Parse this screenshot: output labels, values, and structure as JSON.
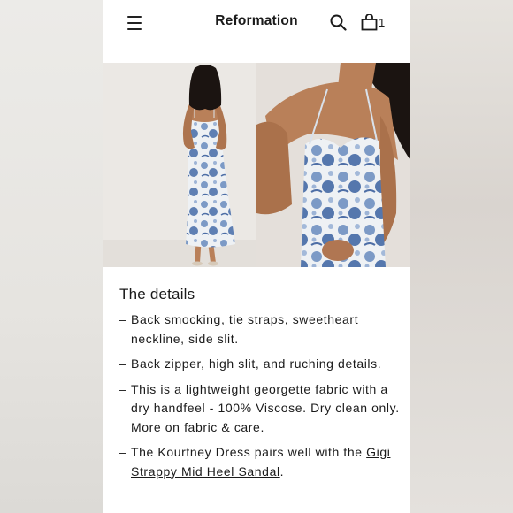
{
  "header": {
    "brand": "Reformation",
    "cart_count": "1"
  },
  "icons": [
    "menu-icon",
    "search-icon",
    "bag-icon"
  ],
  "details": {
    "title": "The details",
    "items": [
      {
        "text": "Back smocking, tie straps, sweetheart neckline, side slit."
      },
      {
        "text": "Back zipper, high slit, and ruching details."
      },
      {
        "text_before": "This is a lightweight georgette fabric with a dry handfeel - 100% Viscose. Dry clean only. More on ",
        "link": "fabric & care",
        "text_after": "."
      },
      {
        "text_before": "The Kourtney Dress pairs well with the ",
        "link": "Gigi Strappy Mid Heel Sandal",
        "text_after": "."
      }
    ],
    "dash": "–"
  },
  "colors": {
    "dress_blue": "#6f8fbd",
    "dress_base": "#eef1f4",
    "skin": "#b9805a",
    "hair": "#1b1411"
  }
}
